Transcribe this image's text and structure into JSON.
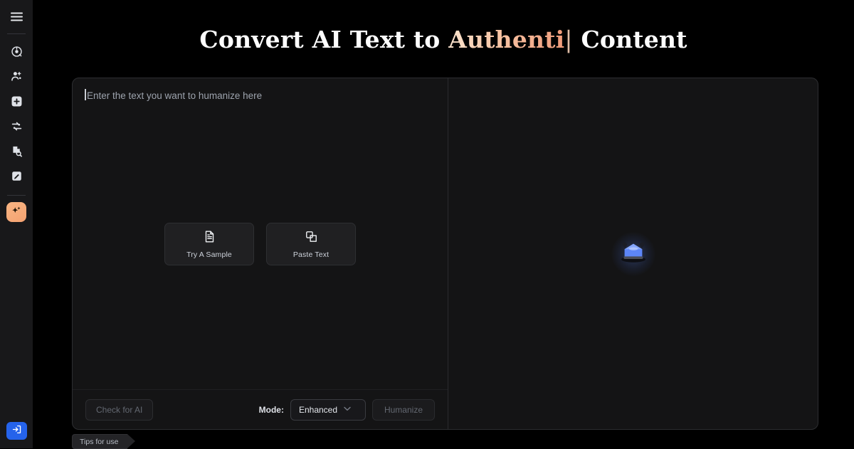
{
  "sidebar": {
    "menu_toggle": {
      "icon": "hamburger-menu-icon",
      "label": "Menu"
    },
    "items": [
      {
        "icon": "ai-detector-icon",
        "label": "AI Detector"
      },
      {
        "icon": "humanizer-hand-icon",
        "label": "AI Humanizer"
      },
      {
        "icon": "plus-square-icon",
        "label": "New"
      },
      {
        "icon": "paraphraser-icon",
        "label": "Paraphraser"
      },
      {
        "icon": "plagiarism-search-icon",
        "label": "Plagiarism Checker"
      },
      {
        "icon": "edit-document-icon",
        "label": "Editor"
      }
    ],
    "active_item": {
      "icon": "sparkles-icon",
      "label": "AI Humanizer"
    },
    "login": {
      "icon": "login-arrow-icon",
      "label": "Sign in"
    },
    "colors": {
      "active_bg": "#f7a871",
      "login_bg": "#2563eb",
      "background": "#18181a"
    }
  },
  "header": {
    "title_prefix": "Convert AI Text to ",
    "title_accent": "Authenti",
    "title_caret": "|",
    "title_suffix": " Content",
    "accent_color": "#f4b18a"
  },
  "editor": {
    "placeholder": "Enter the text you want to humanize here",
    "value": "",
    "quick_actions": [
      {
        "label": "Try A Sample",
        "icon": "document-text-icon"
      },
      {
        "label": "Paste Text",
        "icon": "copy-layers-icon"
      }
    ],
    "footer": {
      "check_ai_label": "Check for AI",
      "check_ai_disabled": true,
      "mode_label": "Mode:",
      "mode_value": "Enhanced",
      "mode_options": [
        "Enhanced"
      ],
      "mode_caret_icon": "chevron-down-icon",
      "humanize_label": "Humanize",
      "humanize_disabled": true
    }
  },
  "output": {
    "placeholder_icon": "robot-bot-icon",
    "text": "",
    "glow_color": "#6b8cff"
  },
  "tips": {
    "label": "Tips for use"
  }
}
